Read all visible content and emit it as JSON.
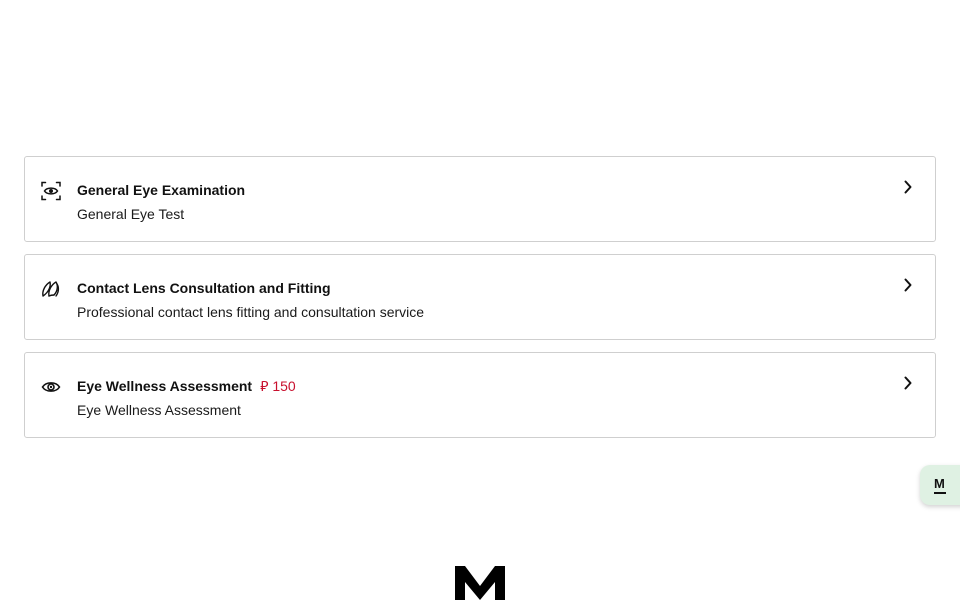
{
  "services": [
    {
      "title": "General Eye Examination",
      "subtitle": "General Eye Test",
      "price": "",
      "icon": "eye-scan-icon"
    },
    {
      "title": "Contact Lens Consultation and Fitting",
      "subtitle": "Professional contact lens fitting and consultation service",
      "price": "",
      "icon": "contact-lens-icon"
    },
    {
      "title": "Eye Wellness Assessment",
      "subtitle": "Eye Wellness Assessment",
      "price": "⃁ 150",
      "icon": "eye-icon"
    }
  ],
  "floating_badge": {
    "label": "M"
  },
  "colors": {
    "price": "#c8102e",
    "card_border": "#cfcfcf",
    "badge_background": "#dff1e3"
  }
}
